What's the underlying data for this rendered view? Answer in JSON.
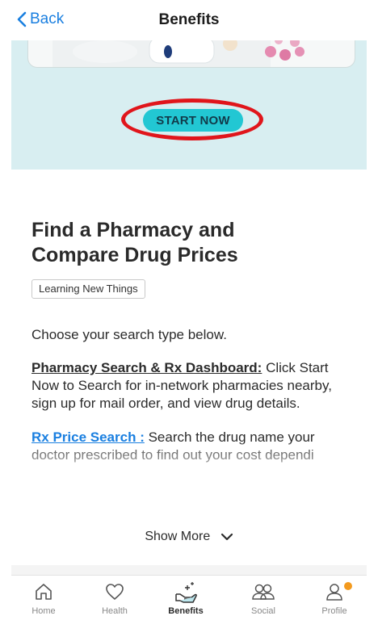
{
  "header": {
    "back_label": "Back",
    "title": "Benefits"
  },
  "hero": {
    "start_label": "START NOW"
  },
  "content": {
    "heading_line1": "Find a Pharmacy and",
    "heading_line2": "Compare Drug Prices",
    "tag": "Learning New Things",
    "intro": "Choose your search type below.",
    "pharmacy_link": "Pharmacy Search & Rx Dashboard:",
    "pharmacy_text": " Click Start Now to Search for in-network pharmacies nearby, sign up for mail order, and view drug details.",
    "rx_link": "Rx Price Search :",
    "rx_text": " Search the drug name your doctor prescribed to find out your cost dependi",
    "show_more": "Show More"
  },
  "tabbar": {
    "items": [
      {
        "label": "Home",
        "icon": "home-icon"
      },
      {
        "label": "Health",
        "icon": "heart-icon"
      },
      {
        "label": "Benefits",
        "icon": "benefits-hand-icon"
      },
      {
        "label": "Social",
        "icon": "people-icon"
      },
      {
        "label": "Profile",
        "icon": "person-icon"
      }
    ]
  },
  "colors": {
    "accent_blue": "#1a7fe0",
    "hero_bg": "#d8eef1",
    "start_button": "#22c7d3",
    "highlight_ring": "#e0151b",
    "notification_dot": "#f39a1e"
  }
}
